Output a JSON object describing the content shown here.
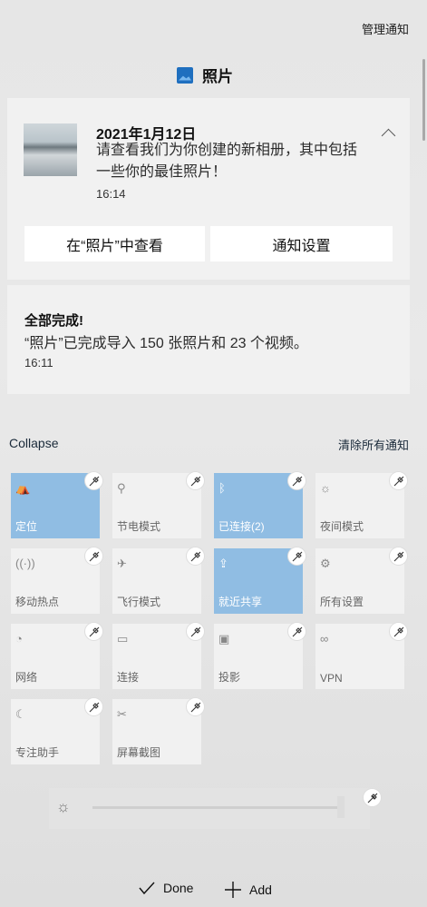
{
  "header": {
    "manage_link": "管理通知",
    "app_name": "照片"
  },
  "notifications": [
    {
      "title": "2021年1月12日",
      "body": "请查看我们为你创建的新相册，其中包括一些你的最佳照片！",
      "time": "16:14",
      "actions": [
        "在“照片”中查看",
        "通知设置"
      ]
    },
    {
      "title": "全部完成!",
      "body": "“照片”已完成导入 150 张照片和 23 个视频。",
      "time": "16:11"
    }
  ],
  "action_center": {
    "collapse_label": "Collapse",
    "clear_all_label": "清除所有通知"
  },
  "tiles": [
    {
      "label": "定位",
      "icon": "location-icon",
      "active": true
    },
    {
      "label": "节电模式",
      "icon": "battery-saver-icon",
      "active": false
    },
    {
      "label": "已连接(2)",
      "icon": "bluetooth-icon",
      "active": true
    },
    {
      "label": "夜间模式",
      "icon": "night-light-icon",
      "active": false
    },
    {
      "label": "移动热点",
      "icon": "hotspot-icon",
      "active": false
    },
    {
      "label": "飞行模式",
      "icon": "airplane-icon",
      "active": false
    },
    {
      "label": "就近共享",
      "icon": "nearby-share-icon",
      "active": true
    },
    {
      "label": "所有设置",
      "icon": "gear-icon",
      "active": false
    },
    {
      "label": "网络",
      "icon": "network-icon",
      "active": false
    },
    {
      "label": "连接",
      "icon": "connect-icon",
      "active": false
    },
    {
      "label": "投影",
      "icon": "project-icon",
      "active": false
    },
    {
      "label": "VPN",
      "icon": "vpn-icon",
      "active": false
    },
    {
      "label": "专注助手",
      "icon": "focus-assist-icon",
      "active": false
    },
    {
      "label": "屏幕截图",
      "icon": "screen-snip-icon",
      "active": false
    }
  ],
  "footer": {
    "done_label": "Done",
    "add_label": "Add"
  },
  "colors": {
    "active_tile": "#90bde3",
    "inactive_tile": "#f1f1f1",
    "card_bg": "#f1f1f1"
  }
}
